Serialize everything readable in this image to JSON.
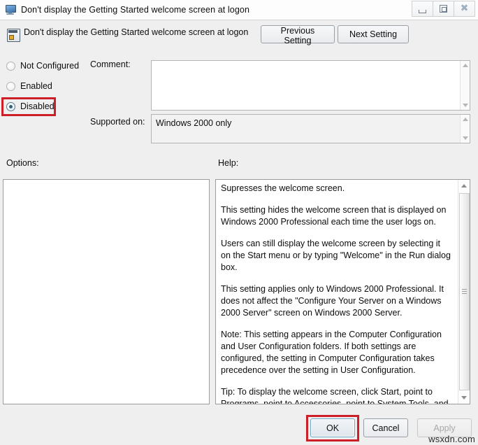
{
  "window": {
    "title": "Don't display the Getting Started welcome screen at logon",
    "icon": "computer-monitor-icon",
    "controls": {
      "minimize": "minimize-icon",
      "restore": "restore-icon",
      "close": "close-icon"
    }
  },
  "header": {
    "icon": "policy-setting-icon",
    "title": "Don't display the Getting Started welcome screen at logon",
    "previous_setting_label": "Previous Setting",
    "next_setting_label": "Next Setting"
  },
  "state": {
    "options": [
      {
        "id": "not-configured",
        "label": "Not Configured",
        "selected": false
      },
      {
        "id": "enabled",
        "label": "Enabled",
        "selected": false
      },
      {
        "id": "disabled",
        "label": "Disabled",
        "selected": true
      }
    ],
    "selected_value": "Disabled"
  },
  "comment": {
    "label": "Comment:",
    "value": "",
    "placeholder": ""
  },
  "supported_on": {
    "label": "Supported on:",
    "value": "Windows 2000 only"
  },
  "panels": {
    "options_label": "Options:",
    "options_content": "",
    "help_label": "Help:",
    "help_paragraphs": [
      "Supresses the welcome screen.",
      "This setting hides the welcome screen that is displayed on Windows 2000 Professional each time the user logs on.",
      "Users can still display the welcome screen by selecting it on the Start menu or by typing \"Welcome\" in the Run dialog box.",
      "This setting applies only to Windows 2000 Professional. It does not affect the \"Configure Your Server on a Windows 2000 Server\" screen on Windows 2000 Server.",
      "Note: This setting appears in the Computer Configuration and User Configuration folders. If both settings are configured, the setting in Computer Configuration takes precedence over the setting in User Configuration.",
      "Tip: To display the welcome screen, click Start, point to Programs, point to Accessories, point to System Tools, and then click \"Getting Started.\" To suppress the welcome screen without specifying a setting, clear the \"Show this screen at startup\" check"
    ]
  },
  "footer": {
    "ok_label": "OK",
    "cancel_label": "Cancel",
    "apply_label": "Apply",
    "apply_disabled": true
  },
  "annotations": {
    "highlight_color": "#cc1f27",
    "highlighted_elements": [
      "Disabled",
      "OK"
    ]
  },
  "watermark": {
    "text": "wsxdn.com"
  }
}
